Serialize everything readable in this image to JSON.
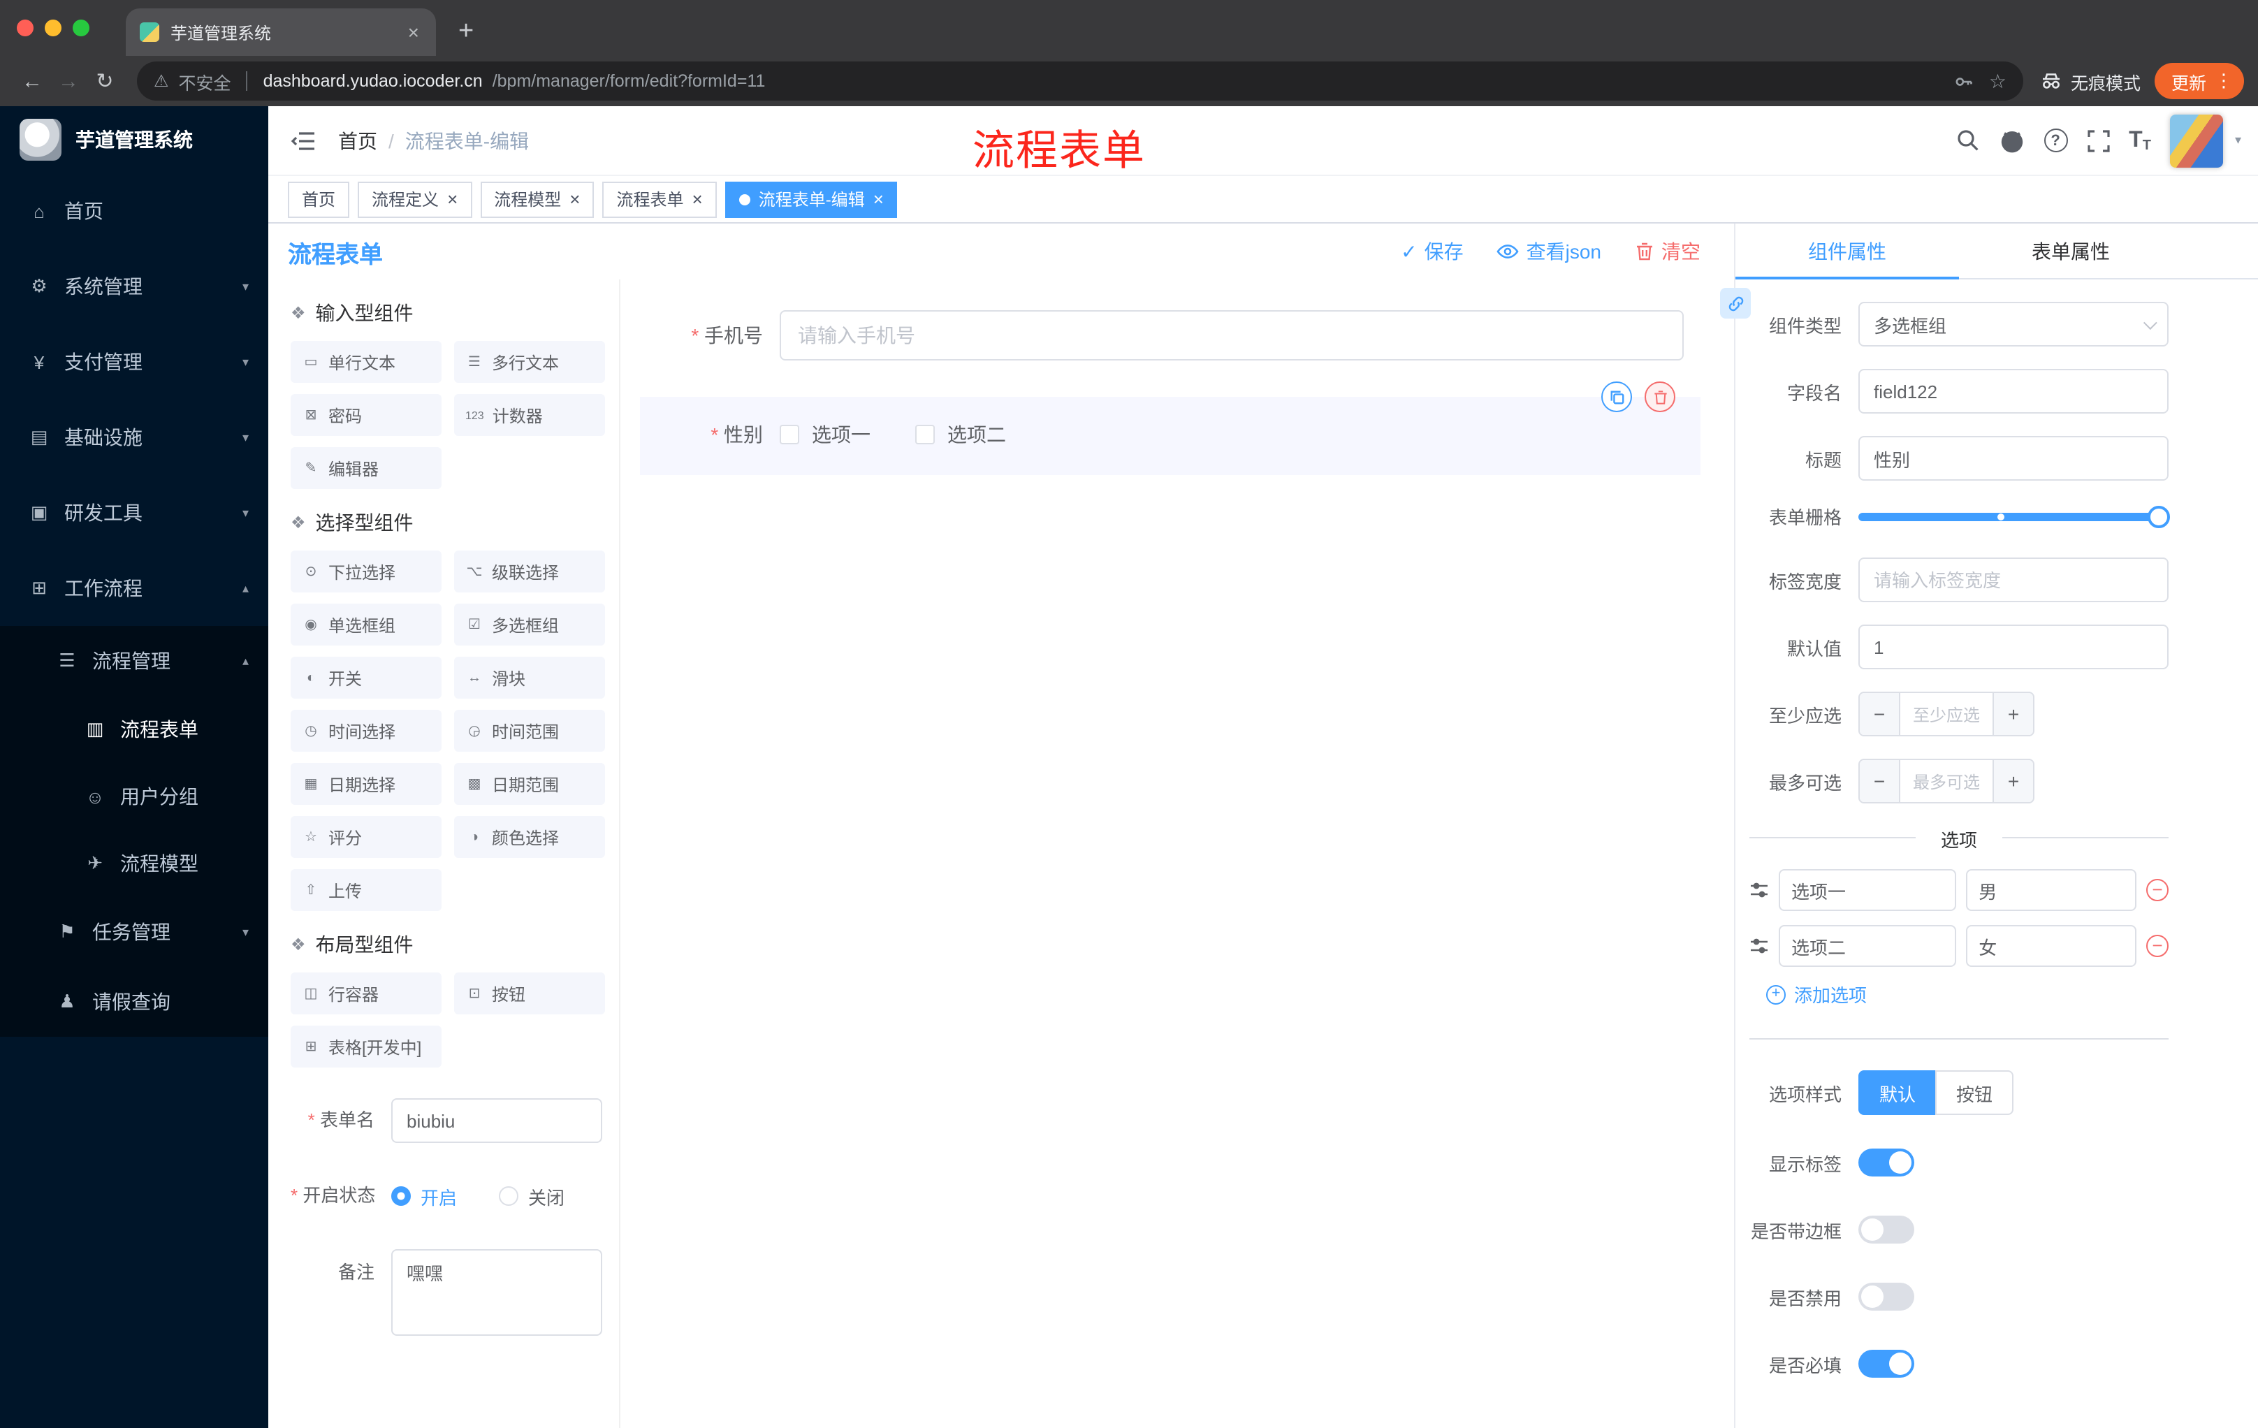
{
  "colors": {
    "accent": "#409eff",
    "danger": "#f56c6c",
    "sidebar_bg": "#001529",
    "update_button": "#f2652a"
  },
  "browser": {
    "tab_title": "芋道管理系统",
    "new_tab": "+",
    "back": "←",
    "forward": "→",
    "reload": "↻",
    "security_icon": "⚠",
    "security_label": "不安全",
    "url_host": "dashboard.yudao.iocoder.cn",
    "url_path": "/bpm/manager/form/edit?formId=11",
    "bookmark_star": "☆",
    "incognito_label": "无痕模式",
    "update_label": "更新",
    "menu_kebab": "⋮"
  },
  "sidebar": {
    "logo_text": "芋道管理系统",
    "items": [
      {
        "label": "首页",
        "icon": "home-icon",
        "level": 0
      },
      {
        "label": "系统管理",
        "icon": "gear-icon",
        "level": 0,
        "chevron": "down"
      },
      {
        "label": "支付管理",
        "icon": "payment-icon",
        "level": 0,
        "chevron": "down"
      },
      {
        "label": "基础设施",
        "icon": "infrastructure-icon",
        "level": 0,
        "chevron": "down"
      },
      {
        "label": "研发工具",
        "icon": "devtools-icon",
        "level": 0,
        "chevron": "down"
      },
      {
        "label": "工作流程",
        "icon": "workflow-icon",
        "level": 0,
        "chevron": "up"
      },
      {
        "label": "流程管理",
        "icon": "process-management-icon",
        "level": 1,
        "chevron": "up",
        "dark": true
      },
      {
        "label": "流程表单",
        "icon": "process-form-icon",
        "level": 2,
        "dark": true,
        "active": true
      },
      {
        "label": "用户分组",
        "icon": "user-group-icon",
        "level": 2,
        "dark": true
      },
      {
        "label": "流程模型",
        "icon": "process-model-icon",
        "level": 2,
        "dark": true
      },
      {
        "label": "任务管理",
        "icon": "task-management-icon",
        "level": 1,
        "chevron": "down",
        "dark": true
      },
      {
        "label": "请假查询",
        "icon": "leave-query-icon",
        "level": 1,
        "dark": true
      }
    ]
  },
  "header": {
    "breadcrumb_home": "首页",
    "breadcrumb_sep": "/",
    "breadcrumb_current": "流程表单-编辑",
    "annotation": "流程表单"
  },
  "tags": [
    {
      "label": "首页",
      "closable": false,
      "active": false
    },
    {
      "label": "流程定义",
      "closable": true,
      "active": false
    },
    {
      "label": "流程模型",
      "closable": true,
      "active": false
    },
    {
      "label": "流程表单",
      "closable": true,
      "active": false
    },
    {
      "label": "流程表单-编辑",
      "closable": true,
      "active": true
    }
  ],
  "designer": {
    "title": "流程表单",
    "save": "保存",
    "view_json": "查看json",
    "clear": "清空"
  },
  "palette": {
    "groups": [
      {
        "title": "输入型组件",
        "items": [
          {
            "label": "单行文本",
            "icon": "single-line-text-icon"
          },
          {
            "label": "多行文本",
            "icon": "multi-line-text-icon"
          },
          {
            "label": "密码",
            "icon": "password-icon"
          },
          {
            "label": "计数器",
            "icon": "counter-icon"
          },
          {
            "label": "编辑器",
            "icon": "editor-icon"
          }
        ]
      },
      {
        "title": "选择型组件",
        "items": [
          {
            "label": "下拉选择",
            "icon": "select-icon"
          },
          {
            "label": "级联选择",
            "icon": "cascader-icon"
          },
          {
            "label": "单选框组",
            "icon": "radio-group-icon"
          },
          {
            "label": "多选框组",
            "icon": "checkbox-group-icon"
          },
          {
            "label": "开关",
            "icon": "switch-icon"
          },
          {
            "label": "滑块",
            "icon": "slider-icon"
          },
          {
            "label": "时间选择",
            "icon": "time-picker-icon"
          },
          {
            "label": "时间范围",
            "icon": "time-range-icon"
          },
          {
            "label": "日期选择",
            "icon": "date-picker-icon"
          },
          {
            "label": "日期范围",
            "icon": "date-range-icon"
          },
          {
            "label": "评分",
            "icon": "rate-icon"
          },
          {
            "label": "颜色选择",
            "icon": "color-picker-icon"
          },
          {
            "label": "上传",
            "icon": "upload-icon"
          }
        ]
      },
      {
        "title": "布局型组件",
        "items": [
          {
            "label": "行容器",
            "icon": "row-container-icon"
          },
          {
            "label": "按钮",
            "icon": "button-icon"
          },
          {
            "label": "表格[开发中]",
            "icon": "table-icon"
          }
        ]
      }
    ]
  },
  "left_form": {
    "form_name_label": "表单名",
    "form_name_value": "biubiu",
    "status_label": "开启状态",
    "status_on": "开启",
    "status_off": "关闭",
    "remark_label": "备注",
    "remark_value": "嘿嘿"
  },
  "canvas": {
    "phone_label": "手机号",
    "phone_placeholder": "请输入手机号",
    "gender_label": "性别",
    "gender_option1": "选项一",
    "gender_option2": "选项二"
  },
  "props": {
    "tab_component": "组件属性",
    "tab_form": "表单属性",
    "component_type_label": "组件类型",
    "component_type_value": "多选框组",
    "field_name_label": "字段名",
    "field_name_value": "field122",
    "title_label": "标题",
    "title_value": "性别",
    "grid_label": "表单栅格",
    "label_width_label": "标签宽度",
    "label_width_placeholder": "请输入标签宽度",
    "default_label": "默认值",
    "default_value": "1",
    "min_label": "至少应选",
    "min_placeholder": "至少应选",
    "max_label": "最多可选",
    "max_placeholder": "最多可选",
    "options_title": "选项",
    "options": [
      {
        "name": "选项一",
        "value": "男"
      },
      {
        "name": "选项二",
        "value": "女"
      }
    ],
    "add_option": "添加选项",
    "style_label": "选项样式",
    "style_default": "默认",
    "style_button": "按钮",
    "toggles": [
      {
        "label": "显示标签",
        "on": true
      },
      {
        "label": "是否带边框",
        "on": false
      },
      {
        "label": "是否禁用",
        "on": false
      },
      {
        "label": "是否必填",
        "on": true
      }
    ]
  }
}
